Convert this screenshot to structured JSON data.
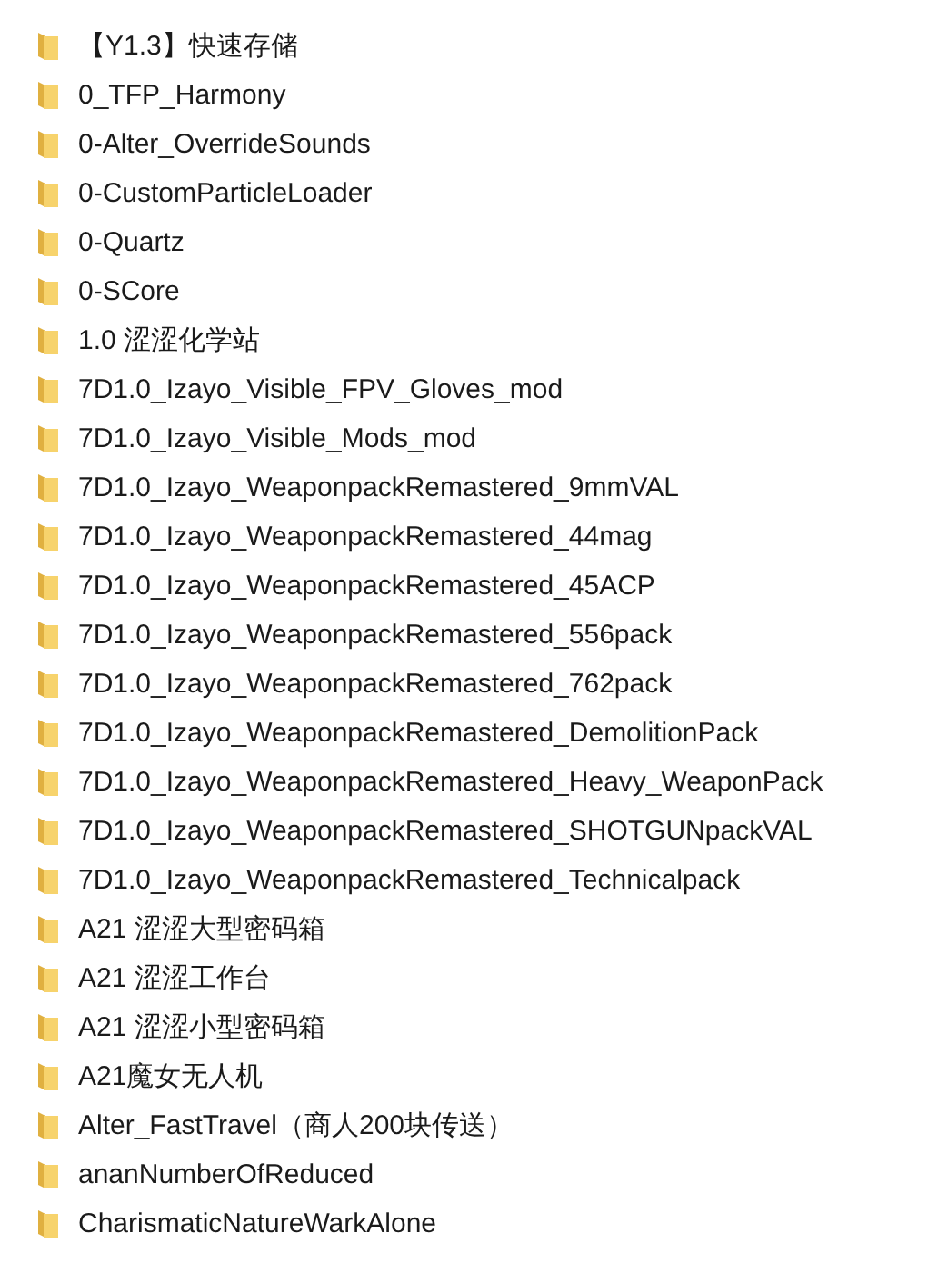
{
  "folders": [
    {
      "name": "【Y1.3】快速存储"
    },
    {
      "name": "0_TFP_Harmony"
    },
    {
      "name": "0-Alter_OverrideSounds"
    },
    {
      "name": "0-CustomParticleLoader"
    },
    {
      "name": "0-Quartz"
    },
    {
      "name": "0-SCore"
    },
    {
      "name": "1.0 涩涩化学站"
    },
    {
      "name": "7D1.0_Izayo_Visible_FPV_Gloves_mod"
    },
    {
      "name": "7D1.0_Izayo_Visible_Mods_mod"
    },
    {
      "name": "7D1.0_Izayo_WeaponpackRemastered_9mmVAL"
    },
    {
      "name": "7D1.0_Izayo_WeaponpackRemastered_44mag"
    },
    {
      "name": "7D1.0_Izayo_WeaponpackRemastered_45ACP"
    },
    {
      "name": "7D1.0_Izayo_WeaponpackRemastered_556pack"
    },
    {
      "name": "7D1.0_Izayo_WeaponpackRemastered_762pack"
    },
    {
      "name": "7D1.0_Izayo_WeaponpackRemastered_DemolitionPack"
    },
    {
      "name": "7D1.0_Izayo_WeaponpackRemastered_Heavy_WeaponPack"
    },
    {
      "name": "7D1.0_Izayo_WeaponpackRemastered_SHOTGUNpackVAL"
    },
    {
      "name": "7D1.0_Izayo_WeaponpackRemastered_Technicalpack"
    },
    {
      "name": "A21 涩涩大型密码箱"
    },
    {
      "name": "A21 涩涩工作台"
    },
    {
      "name": "A21 涩涩小型密码箱"
    },
    {
      "name": "A21魔女无人机"
    },
    {
      "name": "Alter_FastTravel（商人200块传送）"
    },
    {
      "name": "ananNumberOfReduced"
    },
    {
      "name": "CharismaticNatureWarkAlone"
    }
  ]
}
